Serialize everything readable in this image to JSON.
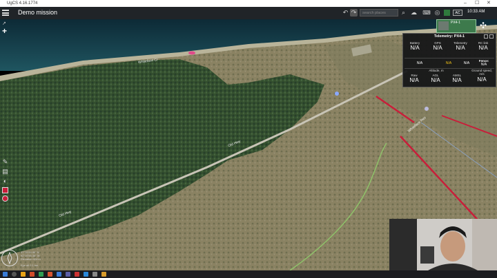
{
  "window": {
    "title": "UgCS 4.16.1774",
    "min": "–",
    "max": "☐",
    "close": "✕"
  },
  "toolbar": {
    "mission_name": "Demo mission",
    "search_placeholder": "search places",
    "ac_label": "AC",
    "time": "10:33 AM"
  },
  "vehicle_card": {
    "name": "PX4-1"
  },
  "telemetry": {
    "title": "Telemetry: PX4-1",
    "row1": [
      {
        "label": "Battery",
        "value": "N/A"
      },
      {
        "label": "GPS",
        "value": "N/A"
      },
      {
        "label": "Telemetry",
        "value": "N/A"
      },
      {
        "label": "RC link",
        "value": "N/A"
      }
    ],
    "row2": [
      {
        "label": "",
        "value": "N/A"
      },
      {
        "label": "",
        "value": "N/A"
      },
      {
        "label": "",
        "value": "N/A"
      },
      {
        "label": "Fence:",
        "value": "N/A"
      }
    ],
    "altitude_label": "Altitude, m",
    "ground_speed_label": "Ground speed, m/s",
    "row3": [
      {
        "label": "Raw",
        "value": "N/A"
      },
      {
        "label": "AGL",
        "value": "N/A"
      },
      {
        "label": "AMSL",
        "value": "N/A"
      },
      {
        "label": "",
        "value": "N/A"
      }
    ]
  },
  "map": {
    "road_labels": [
      "Whiteface Cr",
      "Old Hwy",
      "Old Hwy",
      "Whiteface Res"
    ],
    "coords_line1": "47°20'34.96\" N",
    "coords_line2": "92°19'55.46\" W",
    "elevation": "Elevation 424 m",
    "scale": "Eye alt 2.1 km"
  },
  "colors": {
    "accent": "#3d7a4c",
    "mission_red": "#c81e3a",
    "warning_yellow": "#f5c518"
  },
  "icons": [
    "menu-icon",
    "undo-icon",
    "redo-icon",
    "search-icon",
    "settings-icon",
    "keyboard-icon",
    "camera-icon",
    "battery-icon",
    "plus-icon",
    "ruler-icon",
    "layers-icon",
    "drone-icon",
    "compass-icon"
  ]
}
